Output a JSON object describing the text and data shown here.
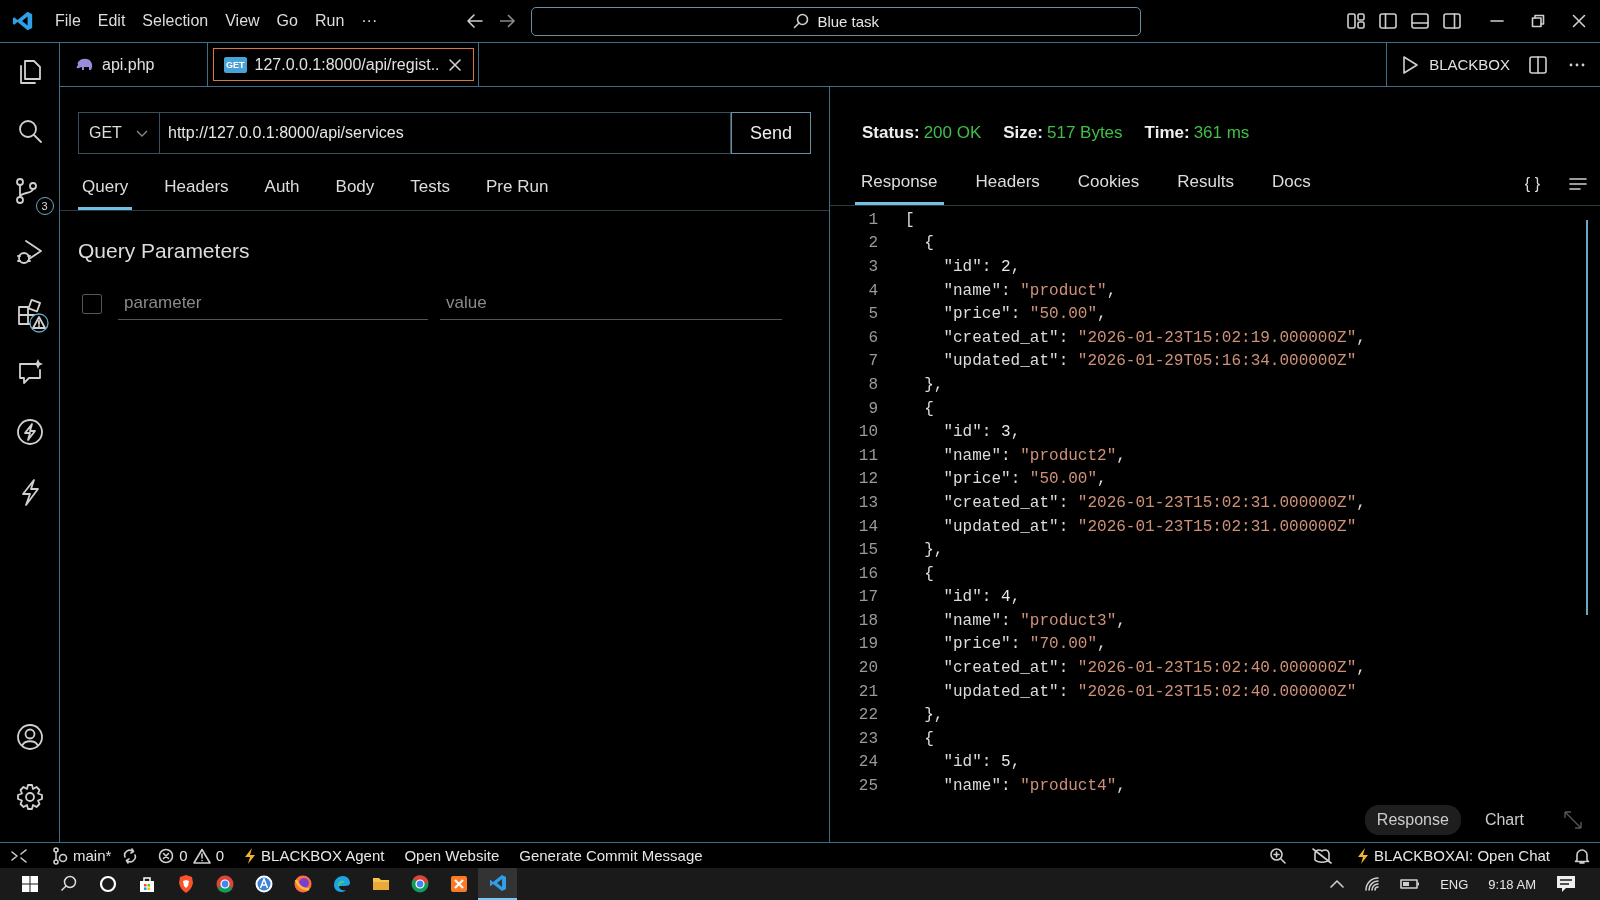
{
  "title_bar": {
    "menu": [
      "File",
      "Edit",
      "Selection",
      "View",
      "Go",
      "Run",
      "···"
    ],
    "search": "Blue task"
  },
  "activity_bar": {
    "source_control_badge": "3"
  },
  "tabs": [
    {
      "label": "api.php",
      "kind": "php",
      "selected": false
    },
    {
      "label": "127.0.0.1:8000/api/regist..",
      "kind": "request",
      "badge": "GET",
      "selected": true
    }
  ],
  "editor_actions": {
    "label": "BLACKBOX"
  },
  "request": {
    "method": "GET",
    "url": "http://127.0.0.1:8000/api/services",
    "send": "Send",
    "tabs": [
      {
        "label": "Query",
        "selected": true
      },
      {
        "label": "Headers",
        "selected": false
      },
      {
        "label": "Auth",
        "selected": false
      },
      {
        "label": "Body",
        "selected": false
      },
      {
        "label": "Tests",
        "selected": false
      },
      {
        "label": "Pre Run",
        "selected": false
      }
    ],
    "section_title": "Query Parameters",
    "params": [
      {
        "checked": false,
        "name_placeholder": "parameter",
        "value_placeholder": "value"
      }
    ]
  },
  "response": {
    "stats": [
      {
        "label": "Status:",
        "value": "200 OK"
      },
      {
        "label": "Size:",
        "value": "517 Bytes"
      },
      {
        "label": "Time:",
        "value": "361 ms"
      }
    ],
    "tabs": [
      {
        "label": "Response",
        "selected": true
      },
      {
        "label": "Headers",
        "selected": false
      },
      {
        "label": "Cookies",
        "selected": false
      },
      {
        "label": "Results",
        "selected": false
      },
      {
        "label": "Docs",
        "selected": false
      }
    ],
    "format_label": "{ }",
    "lines": [
      {
        "number": "1",
        "segments": [
          {
            "kind": "punct",
            "text": "["
          }
        ]
      },
      {
        "number": "2",
        "segments": [
          {
            "kind": "punct",
            "text": "  {"
          }
        ]
      },
      {
        "number": "3",
        "segments": [
          {
            "kind": "key",
            "text": "    \"id\""
          },
          {
            "kind": "punct",
            "text": ": "
          },
          {
            "kind": "number",
            "text": "2"
          },
          {
            "kind": "punct",
            "text": ","
          }
        ]
      },
      {
        "number": "4",
        "segments": [
          {
            "kind": "key",
            "text": "    \"name\""
          },
          {
            "kind": "punct",
            "text": ": "
          },
          {
            "kind": "string",
            "text": "\"product\""
          },
          {
            "kind": "punct",
            "text": ","
          }
        ]
      },
      {
        "number": "5",
        "segments": [
          {
            "kind": "key",
            "text": "    \"price\""
          },
          {
            "kind": "punct",
            "text": ": "
          },
          {
            "kind": "string",
            "text": "\"50.00\""
          },
          {
            "kind": "punct",
            "text": ","
          }
        ]
      },
      {
        "number": "6",
        "segments": [
          {
            "kind": "key",
            "text": "    \"created_at\""
          },
          {
            "kind": "punct",
            "text": ": "
          },
          {
            "kind": "string",
            "text": "\"2026-01-23T15:02:19.000000Z\""
          },
          {
            "kind": "punct",
            "text": ","
          }
        ]
      },
      {
        "number": "7",
        "segments": [
          {
            "kind": "key",
            "text": "    \"updated_at\""
          },
          {
            "kind": "punct",
            "text": ": "
          },
          {
            "kind": "string",
            "text": "\"2026-01-29T05:16:34.000000Z\""
          }
        ]
      },
      {
        "number": "8",
        "segments": [
          {
            "kind": "punct",
            "text": "  },"
          }
        ]
      },
      {
        "number": "9",
        "segments": [
          {
            "kind": "punct",
            "text": "  {"
          }
        ]
      },
      {
        "number": "10",
        "segments": [
          {
            "kind": "key",
            "text": "    \"id\""
          },
          {
            "kind": "punct",
            "text": ": "
          },
          {
            "kind": "number",
            "text": "3"
          },
          {
            "kind": "punct",
            "text": ","
          }
        ]
      },
      {
        "number": "11",
        "segments": [
          {
            "kind": "key",
            "text": "    \"name\""
          },
          {
            "kind": "punct",
            "text": ": "
          },
          {
            "kind": "string",
            "text": "\"product2\""
          },
          {
            "kind": "punct",
            "text": ","
          }
        ]
      },
      {
        "number": "12",
        "segments": [
          {
            "kind": "key",
            "text": "    \"price\""
          },
          {
            "kind": "punct",
            "text": ": "
          },
          {
            "kind": "string",
            "text": "\"50.00\""
          },
          {
            "kind": "punct",
            "text": ","
          }
        ]
      },
      {
        "number": "13",
        "segments": [
          {
            "kind": "key",
            "text": "    \"created_at\""
          },
          {
            "kind": "punct",
            "text": ": "
          },
          {
            "kind": "string",
            "text": "\"2026-01-23T15:02:31.000000Z\""
          },
          {
            "kind": "punct",
            "text": ","
          }
        ]
      },
      {
        "number": "14",
        "segments": [
          {
            "kind": "key",
            "text": "    \"updated_at\""
          },
          {
            "kind": "punct",
            "text": ": "
          },
          {
            "kind": "string",
            "text": "\"2026-01-23T15:02:31.000000Z\""
          }
        ]
      },
      {
        "number": "15",
        "segments": [
          {
            "kind": "punct",
            "text": "  },"
          }
        ]
      },
      {
        "number": "16",
        "segments": [
          {
            "kind": "punct",
            "text": "  {"
          }
        ]
      },
      {
        "number": "17",
        "segments": [
          {
            "kind": "key",
            "text": "    \"id\""
          },
          {
            "kind": "punct",
            "text": ": "
          },
          {
            "kind": "number",
            "text": "4"
          },
          {
            "kind": "punct",
            "text": ","
          }
        ]
      },
      {
        "number": "18",
        "segments": [
          {
            "kind": "key",
            "text": "    \"name\""
          },
          {
            "kind": "punct",
            "text": ": "
          },
          {
            "kind": "string",
            "text": "\"product3\""
          },
          {
            "kind": "punct",
            "text": ","
          }
        ]
      },
      {
        "number": "19",
        "segments": [
          {
            "kind": "key",
            "text": "    \"price\""
          },
          {
            "kind": "punct",
            "text": ": "
          },
          {
            "kind": "string",
            "text": "\"70.00\""
          },
          {
            "kind": "punct",
            "text": ","
          }
        ]
      },
      {
        "number": "20",
        "segments": [
          {
            "kind": "key",
            "text": "    \"created_at\""
          },
          {
            "kind": "punct",
            "text": ": "
          },
          {
            "kind": "string",
            "text": "\"2026-01-23T15:02:40.000000Z\""
          },
          {
            "kind": "punct",
            "text": ","
          }
        ]
      },
      {
        "number": "21",
        "segments": [
          {
            "kind": "key",
            "text": "    \"updated_at\""
          },
          {
            "kind": "punct",
            "text": ": "
          },
          {
            "kind": "string",
            "text": "\"2026-01-23T15:02:40.000000Z\""
          }
        ]
      },
      {
        "number": "22",
        "segments": [
          {
            "kind": "punct",
            "text": "  },"
          }
        ]
      },
      {
        "number": "23",
        "segments": [
          {
            "kind": "punct",
            "text": "  {"
          }
        ]
      },
      {
        "number": "24",
        "segments": [
          {
            "kind": "key",
            "text": "    \"id\""
          },
          {
            "kind": "punct",
            "text": ": "
          },
          {
            "kind": "number",
            "text": "5"
          },
          {
            "kind": "punct",
            "text": ","
          }
        ]
      },
      {
        "number": "25",
        "segments": [
          {
            "kind": "key",
            "text": "    \"name\""
          },
          {
            "kind": "punct",
            "text": ": "
          },
          {
            "kind": "string",
            "text": "\"product4\""
          },
          {
            "kind": "punct",
            "text": ","
          }
        ]
      }
    ],
    "views": [
      {
        "label": "Response",
        "selected": true
      },
      {
        "label": "Chart",
        "selected": false
      }
    ]
  },
  "status_bar": {
    "branch": "main*",
    "errors": "0",
    "warnings": "0",
    "items": [
      "BLACKBOX Agent",
      "Open Website",
      "Generate Commit Message"
    ],
    "chat": "BLACKBOXAI: Open Chat"
  },
  "taskbar": {
    "language": "ENG",
    "time": "9:18 AM"
  }
}
